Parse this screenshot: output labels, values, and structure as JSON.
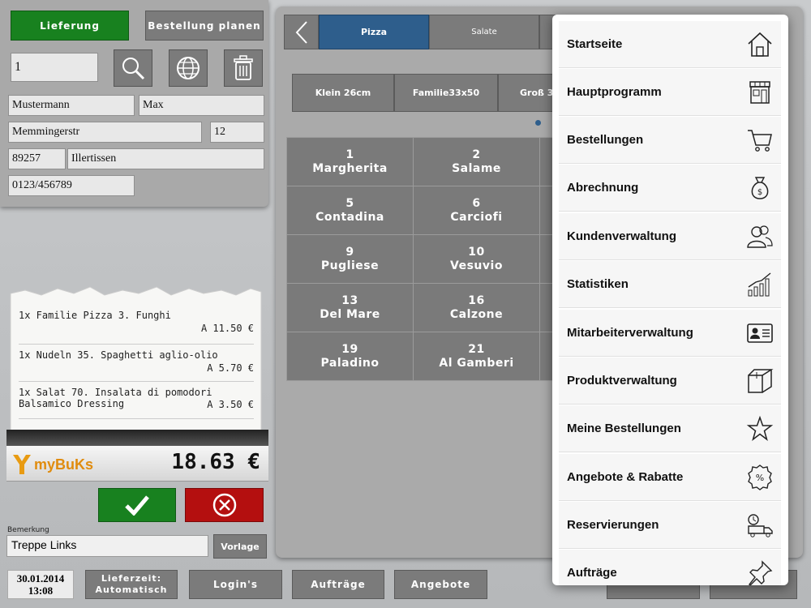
{
  "order_type": {
    "delivery_label": "Lieferung",
    "plan_label": "Bestellung planen"
  },
  "customer": {
    "number": "1",
    "last_name": "Mustermann",
    "first_name": "Max",
    "street": "Memmingerstr",
    "house_no": "12",
    "zip": "89257",
    "city": "Illertissen",
    "phone": "0123/456789"
  },
  "receipt": {
    "items": [
      {
        "line1": "1x Familie Pizza 3. Funghi",
        "line2": "",
        "price": "A 11.50 €"
      },
      {
        "line1": "1x Nudeln 35. Spaghetti aglio-olio",
        "line2": "",
        "price": "A 5.70 €"
      },
      {
        "line1": "1x Salat 70. Insalata di pomodori",
        "line2": "Balsamico Dressing",
        "price": "A 3.50 €"
      }
    ],
    "total": "18.63 €",
    "logo_text": "myBuKs"
  },
  "remark": {
    "label": "Bemerkung",
    "value": "Treppe Links",
    "template_button": "Vorlage"
  },
  "categories": {
    "back_icon": "chevron-left-icon",
    "tabs": [
      "Pizza",
      "Salate"
    ],
    "active": "Pizza"
  },
  "sizes": [
    "Klein 26cm",
    "Familie33x50",
    "Groß 3"
  ],
  "products": [
    {
      "num": "1",
      "name": "Margherita"
    },
    {
      "num": "2",
      "name": "Salame"
    },
    {
      "num": "5",
      "name": "Contadina"
    },
    {
      "num": "6",
      "name": "Carciofi"
    },
    {
      "num": "9",
      "name": "Pugliese"
    },
    {
      "num": "10",
      "name": "Vesuvio"
    },
    {
      "num": "13",
      "name": "Del Mare"
    },
    {
      "num": "16",
      "name": "Calzone"
    },
    {
      "num": "19",
      "name": "Paladino"
    },
    {
      "num": "21",
      "name": "Al Gamberi"
    }
  ],
  "footer": {
    "date": "30.01.2014",
    "time": "13:08",
    "delivery_time_line1": "Lieferzeit:",
    "delivery_time_line2": "Automatisch",
    "logins": "Login's",
    "orders": "Aufträge",
    "offers": "Angebote"
  },
  "menu": {
    "items": [
      {
        "label": "Startseite",
        "icon": "home-icon"
      },
      {
        "label": "Hauptprogramm",
        "icon": "store-icon"
      },
      {
        "label": "Bestellungen",
        "icon": "cart-icon"
      },
      {
        "label": "Abrechnung",
        "icon": "money-bag-icon"
      },
      {
        "label": "Kundenverwaltung",
        "icon": "users-icon"
      },
      {
        "label": "Statistiken",
        "icon": "chart-icon"
      },
      {
        "label": "Mitarbeiterverwaltung",
        "icon": "id-card-icon"
      },
      {
        "label": "Produktverwaltung",
        "icon": "box-icon"
      },
      {
        "label": "Meine Bestellungen",
        "icon": "star-icon"
      },
      {
        "label": "Angebote & Rabatte",
        "icon": "discount-icon"
      },
      {
        "label": "Reservierungen",
        "icon": "delivery-truck-icon"
      },
      {
        "label": "Aufträge",
        "icon": "pin-icon"
      }
    ]
  },
  "colors": {
    "accent_green": "#18811f",
    "accent_red": "#b40f0f",
    "active_tab": "#2e5e8c"
  }
}
